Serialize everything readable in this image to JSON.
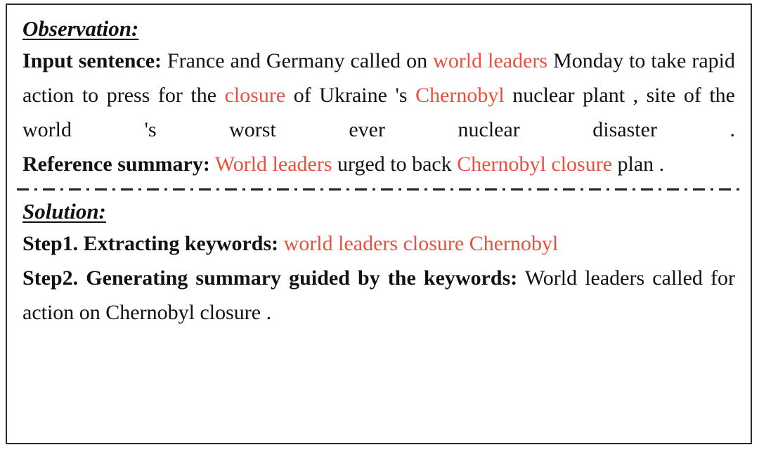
{
  "figure": {
    "highlight_color": "#e8503f",
    "text_color": "#121212",
    "border_color": "#2b2b2b",
    "background": "#ffffff"
  },
  "observation": {
    "heading": "Observation:",
    "input_sentence": {
      "label": "Input sentence:",
      "segments": [
        {
          "text": "France and Germany called on ",
          "highlight": false
        },
        {
          "text": "world leaders",
          "highlight": true
        },
        {
          "text": " Monday to take rapid action to press for the ",
          "highlight": false
        },
        {
          "text": "closure",
          "highlight": true
        },
        {
          "text": " of Ukraine 's ",
          "highlight": false
        },
        {
          "text": "Chernobyl",
          "highlight": true
        },
        {
          "text": " nuclear plant , site of the world 's worst ever nuclear disaster .",
          "highlight": false
        }
      ],
      "plain_text": "France and Germany called on world leaders Monday to take rapid action to press for the closure of Ukraine 's Chernobyl nuclear plant , site of the world 's worst ever nuclear disaster ."
    },
    "reference_summary": {
      "label": "Reference summary:",
      "segments": [
        {
          "text": "World leaders",
          "highlight": true
        },
        {
          "text": " urged to back ",
          "highlight": false
        },
        {
          "text": "Chernobyl closure",
          "highlight": true
        },
        {
          "text": " plan .",
          "highlight": false
        }
      ],
      "plain_text": "World leaders urged to back Chernobyl closure plan ."
    }
  },
  "solution": {
    "heading": "Solution:",
    "step1": {
      "label": "Step1. Extracting keywords:",
      "keywords": "world leaders closure Chernobyl"
    },
    "step2": {
      "label": "Step2. Generating summary guided by the keywords:",
      "summary": "World leaders called for action on Chernobyl closure ."
    }
  }
}
